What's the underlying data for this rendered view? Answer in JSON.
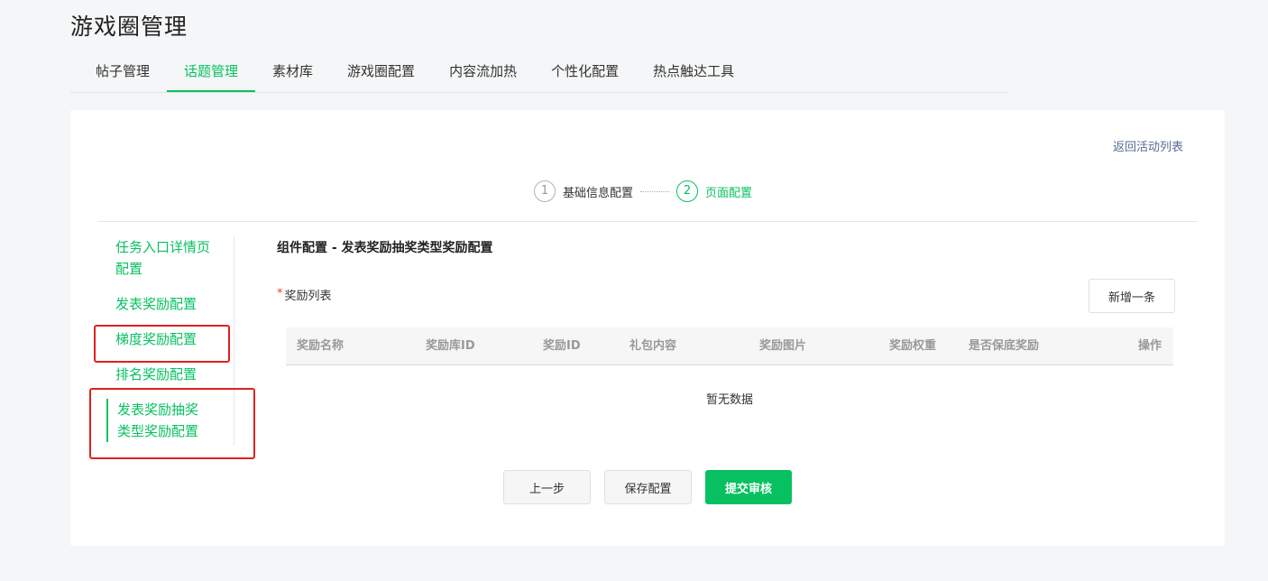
{
  "page": {
    "title": "游戏圈管理"
  },
  "tabs": [
    {
      "label": "帖子管理",
      "active": false
    },
    {
      "label": "话题管理",
      "active": true
    },
    {
      "label": "素材库",
      "active": false
    },
    {
      "label": "游戏圈配置",
      "active": false
    },
    {
      "label": "内容流加热",
      "active": false
    },
    {
      "label": "个性化配置",
      "active": false
    },
    {
      "label": "热点触达工具",
      "active": false
    }
  ],
  "back_link": "返回活动列表",
  "steps": [
    {
      "num": "1",
      "label": "基础信息配置",
      "active": false
    },
    {
      "num": "2",
      "label": "页面配置",
      "active": true
    }
  ],
  "side_nav": [
    {
      "label": "任务入口详情页配置"
    },
    {
      "label": "发表奖励配置"
    },
    {
      "label": "梯度奖励配置"
    },
    {
      "label": "排名奖励配置"
    },
    {
      "label": "发表奖励抽奖类型奖励配置",
      "active": true
    }
  ],
  "section_title": "组件配置 - 发表奖励抽奖类型奖励配置",
  "reward_list": {
    "required_mark": "*",
    "label": "奖励列表",
    "add_button": "新增一条",
    "columns": [
      "奖励名称",
      "奖励库ID",
      "奖励ID",
      "礼包内容",
      "奖励图片",
      "奖励权重",
      "是否保底奖励",
      "操作"
    ],
    "empty_text": "暂无数据"
  },
  "actions": {
    "prev": "上一步",
    "save": "保存配置",
    "submit": "提交审核"
  },
  "colors": {
    "accent": "#07c160",
    "link": "#576b95",
    "annotation": "#e02020"
  }
}
